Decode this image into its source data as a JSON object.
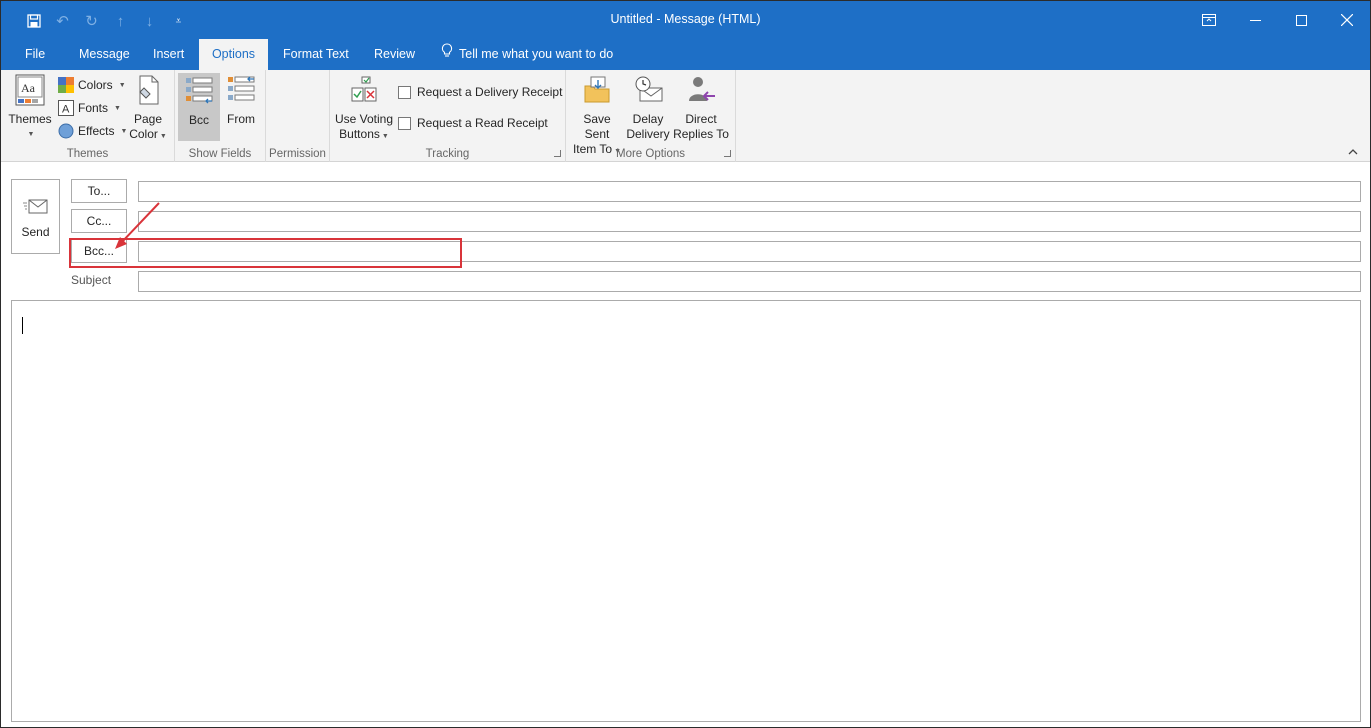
{
  "window": {
    "title": "Untitled - Message (HTML)"
  },
  "tabs": [
    {
      "label": "File"
    },
    {
      "label": "Message"
    },
    {
      "label": "Insert"
    },
    {
      "label": "Options"
    },
    {
      "label": "Format Text"
    },
    {
      "label": "Review"
    }
  ],
  "tell_me": "Tell me what you want to do",
  "ribbon": {
    "themes_group": {
      "label": "Themes",
      "themes_btn": "Themes",
      "colors_btn": "Colors",
      "fonts_btn": "Fonts",
      "effects_btn": "Effects",
      "page_color_line1": "Page",
      "page_color_line2": "Color"
    },
    "show_fields_group": {
      "label": "Show Fields",
      "bcc_btn": "Bcc",
      "from_btn": "From"
    },
    "permission_group": {
      "label": "Permission"
    },
    "tracking_group": {
      "label": "Tracking",
      "voting_line1": "Use Voting",
      "voting_line2": "Buttons",
      "delivery_receipt": "Request a Delivery Receipt",
      "read_receipt": "Request a Read Receipt"
    },
    "more_options_group": {
      "label": "More Options",
      "save_sent_line1": "Save Sent",
      "save_sent_line2": "Item To",
      "delay_line1": "Delay",
      "delay_line2": "Delivery",
      "direct_line1": "Direct",
      "direct_line2": "Replies To"
    }
  },
  "compose": {
    "send_label": "Send",
    "to_btn": "To...",
    "cc_btn": "Cc...",
    "bcc_btn": "Bcc...",
    "subject_label": "Subject",
    "to_value": "",
    "cc_value": "",
    "bcc_value": "",
    "subject_value": ""
  },
  "colors": {
    "accent": "#1e6fc6",
    "highlight": "#d9343a"
  }
}
